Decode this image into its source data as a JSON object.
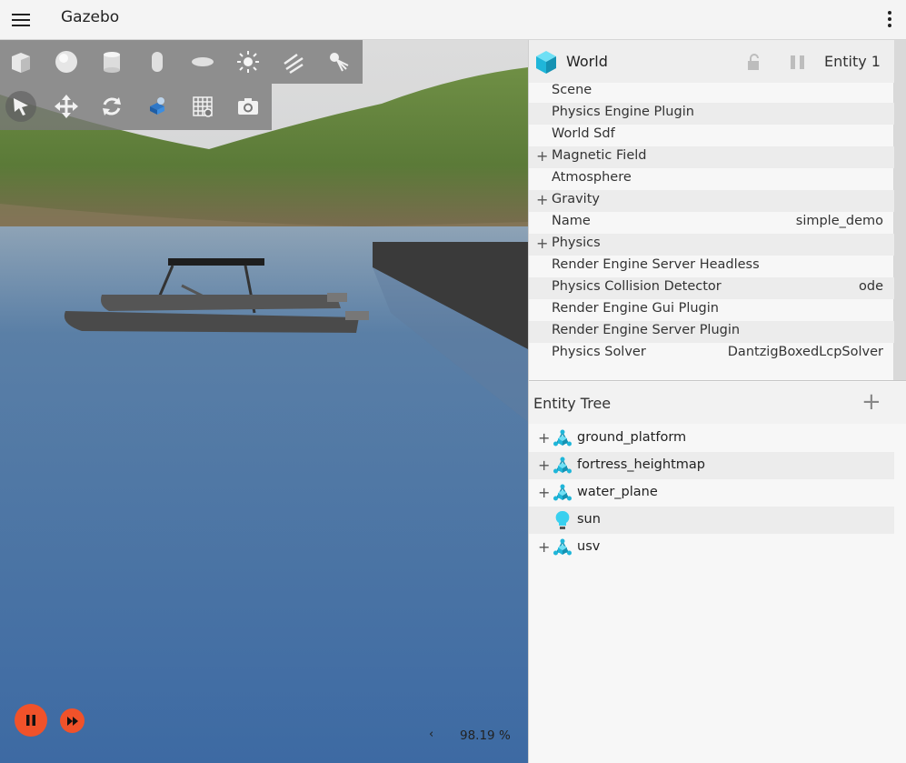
{
  "app": {
    "title": "Gazebo"
  },
  "viewport": {
    "toolbar_shapes": [
      "box-icon",
      "sphere-icon",
      "cylinder-icon",
      "capsule-icon",
      "ellipsoid-icon",
      "point-light-icon",
      "directional-light-icon",
      "spot-light-icon"
    ],
    "toolbar_transform": [
      "select-arrow-icon",
      "translate-icon",
      "rotate-icon",
      "scale-icon",
      "grid-config-icon",
      "screenshot-icon"
    ],
    "real_time_factor": "98.19 %"
  },
  "component_inspector": {
    "entity_name": "World",
    "entity_id": "Entity 1",
    "properties": [
      {
        "name": "Scene",
        "value": "",
        "expandable": false
      },
      {
        "name": "Physics Engine Plugin",
        "value": "",
        "expandable": false
      },
      {
        "name": "World Sdf",
        "value": "",
        "expandable": false
      },
      {
        "name": "Magnetic Field",
        "value": "",
        "expandable": true
      },
      {
        "name": "Atmosphere",
        "value": "",
        "expandable": false
      },
      {
        "name": "Gravity",
        "value": "",
        "expandable": true
      },
      {
        "name": "Name",
        "value": "simple_demo",
        "expandable": false
      },
      {
        "name": "Physics",
        "value": "",
        "expandable": true
      },
      {
        "name": "Render Engine Server Headless",
        "value": "",
        "expandable": false
      },
      {
        "name": "Physics Collision Detector",
        "value": "ode",
        "expandable": false
      },
      {
        "name": "Render Engine Gui Plugin",
        "value": "",
        "expandable": false
      },
      {
        "name": "Render Engine Server Plugin",
        "value": "",
        "expandable": false
      },
      {
        "name": "Physics Solver",
        "value": "DantzigBoxedLcpSolver",
        "expandable": false
      }
    ]
  },
  "entity_tree": {
    "title": "Entity Tree",
    "items": [
      {
        "name": "ground_platform",
        "icon": "model-icon",
        "expandable": true
      },
      {
        "name": "fortress_heightmap",
        "icon": "model-icon",
        "expandable": true
      },
      {
        "name": "water_plane",
        "icon": "model-icon",
        "expandable": true
      },
      {
        "name": "sun",
        "icon": "light-bulb-icon",
        "expandable": false
      },
      {
        "name": "usv",
        "icon": "model-icon",
        "expandable": true
      }
    ]
  },
  "colors": {
    "accent": "#f0522a",
    "cube": "#1fb6d9"
  }
}
